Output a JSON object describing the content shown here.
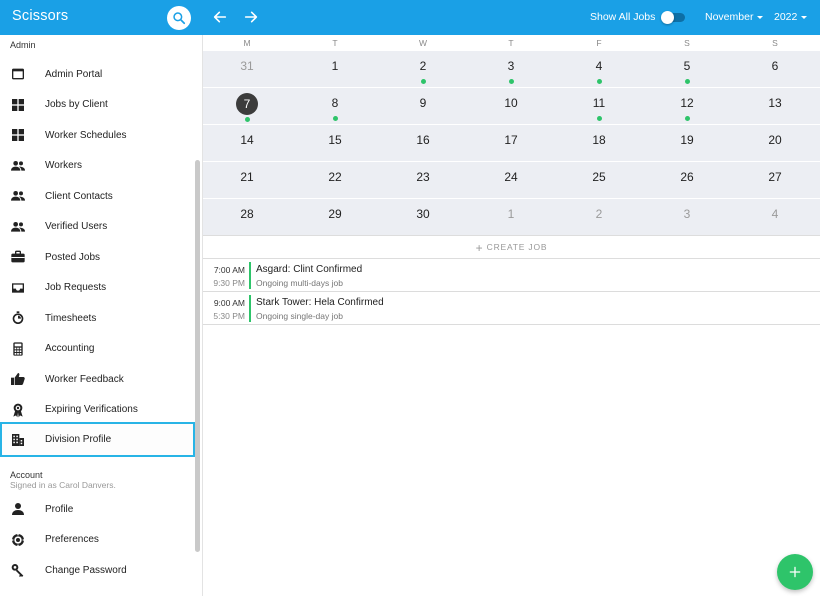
{
  "app": {
    "title": "Scissors"
  },
  "topbar": {
    "show_all_jobs_label": "Show All Jobs",
    "show_all_jobs_on": false,
    "month": "November",
    "year": "2022",
    "accent": "#1aa0e6"
  },
  "sidebar": {
    "admin_label": "Admin",
    "admin_items": [
      {
        "label": "Admin Portal",
        "icon": "window-icon"
      },
      {
        "label": "Jobs by Client",
        "icon": "grid-icon"
      },
      {
        "label": "Worker Schedules",
        "icon": "grid-icon"
      },
      {
        "label": "Workers",
        "icon": "people-icon"
      },
      {
        "label": "Client Contacts",
        "icon": "people-icon"
      },
      {
        "label": "Verified Users",
        "icon": "people-icon"
      },
      {
        "label": "Posted Jobs",
        "icon": "briefcase-icon"
      },
      {
        "label": "Job Requests",
        "icon": "inbox-icon"
      },
      {
        "label": "Timesheets",
        "icon": "stopwatch-icon"
      },
      {
        "label": "Accounting",
        "icon": "calculator-icon"
      },
      {
        "label": "Worker Feedback",
        "icon": "thumbs-up-icon"
      },
      {
        "label": "Expiring Verifications",
        "icon": "award-icon"
      },
      {
        "label": "Division Profile",
        "icon": "building-icon",
        "active": true
      }
    ],
    "account_label": "Account",
    "signed_in": "Signed in as Carol Danvers.",
    "account_items": [
      {
        "label": "Profile",
        "icon": "person-icon"
      },
      {
        "label": "Preferences",
        "icon": "settings-icon"
      },
      {
        "label": "Change Password",
        "icon": "key-icon"
      }
    ]
  },
  "calendar": {
    "weekdays": [
      "M",
      "T",
      "W",
      "T",
      "F",
      "S",
      "S"
    ],
    "weeks": [
      [
        {
          "d": "31",
          "muted": true
        },
        {
          "d": "1"
        },
        {
          "d": "2",
          "dot": true
        },
        {
          "d": "3",
          "dot": true
        },
        {
          "d": "4",
          "dot": true
        },
        {
          "d": "5",
          "dot": true
        },
        {
          "d": "6"
        }
      ],
      [
        {
          "d": "7",
          "today": true,
          "dot": true
        },
        {
          "d": "8",
          "dot": true
        },
        {
          "d": "9"
        },
        {
          "d": "10"
        },
        {
          "d": "11",
          "dot": true
        },
        {
          "d": "12",
          "dot": true
        },
        {
          "d": "13"
        }
      ],
      [
        {
          "d": "14"
        },
        {
          "d": "15"
        },
        {
          "d": "16"
        },
        {
          "d": "17"
        },
        {
          "d": "18"
        },
        {
          "d": "19"
        },
        {
          "d": "20"
        }
      ],
      [
        {
          "d": "21"
        },
        {
          "d": "22"
        },
        {
          "d": "23"
        },
        {
          "d": "24"
        },
        {
          "d": "25"
        },
        {
          "d": "26"
        },
        {
          "d": "27"
        }
      ],
      [
        {
          "d": "28"
        },
        {
          "d": "29"
        },
        {
          "d": "30"
        },
        {
          "d": "1",
          "muted": true
        },
        {
          "d": "2",
          "muted": true
        },
        {
          "d": "3",
          "muted": true
        },
        {
          "d": "4",
          "muted": true
        }
      ]
    ],
    "create_job_label": "CREATE JOB",
    "event_dot_color": "#2ec46a"
  },
  "events": [
    {
      "start": "7:00 AM",
      "end": "9:30 PM",
      "title": "Asgard: Clint Confirmed",
      "subtitle": "Ongoing multi-days job"
    },
    {
      "start": "9:00 AM",
      "end": "5:30 PM",
      "title": "Stark Tower: Hela Confirmed",
      "subtitle": "Ongoing single-day job"
    }
  ],
  "fab": {
    "icon": "plus-icon",
    "color": "#2ec46a"
  }
}
